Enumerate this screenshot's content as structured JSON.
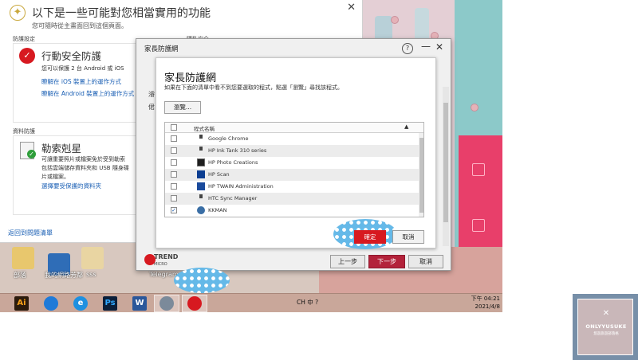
{
  "bg_window": {
    "title": "以下是一些可能對您相當實用的功能",
    "subtitle": "您可隨時從主畫面回到這個頁面。",
    "section1": "防護設定",
    "section1_right": "隱私安全",
    "card1_title": "行動安全防護",
    "card1_body": "您可以保護 2 台 Android 或 iOS",
    "card1_link1": "瞭解在 iOS 裝置上的運作方式",
    "card1_link2": "瞭解在 Android 裝置上的運作方式",
    "section2": "資料防護",
    "card2_title": "勒索剋星",
    "card2_body1": "可讓重要照片或檔案免於受到勒索",
    "card2_body2": "包括雲端儲存資料夾和 USB 隨身碟",
    "card2_body3": "片或檔案。",
    "card2_link": "選擇要受保護的資料夾",
    "back_link": "返回到問題清單"
  },
  "outer": {
    "title": "家長防護網",
    "partial_1": "濬",
    "partial_2": "侰",
    "logo_line1": "TREND",
    "logo_line2": "MICRO",
    "prev": "上一步",
    "next": "下一步",
    "cancel": "取消"
  },
  "inner": {
    "title": "家長防護網",
    "desc": "如果在下面的清單中看不到您要選取的程式，點選「瀏覽」尋找該程式。",
    "browse": "瀏覽...",
    "col_name": "程式名稱",
    "programs": [
      "Google Chrome",
      "HP Ink Tank 310 series",
      "HP Photo Creations",
      "HP Scan",
      "HP TWAIN Administration",
      "HTC Sync Manager",
      "KKMAN"
    ],
    "checkmark": "✓",
    "ok": "確定",
    "cancel": "取消"
  },
  "desktop": {
    "icons": [
      "部落",
      "我的網路芳鄰",
      "sss",
      "Telegram"
    ]
  },
  "taskbar": {
    "ai": "Ai",
    "ie": "e",
    "ps": "Ps",
    "word": "W",
    "tray": "CH 中 ?",
    "time": "下午 04:21",
    "date": "2021/4/8"
  },
  "watermark": {
    "name": "ONLYYUSUKE",
    "sub": "悠遊旅遊部落格"
  },
  "colors": {
    "trend_red": "#d71920",
    "next_button": "#b3223a",
    "link_blue": "#1a5fb4",
    "highlight_blue": "#65b9e8"
  }
}
